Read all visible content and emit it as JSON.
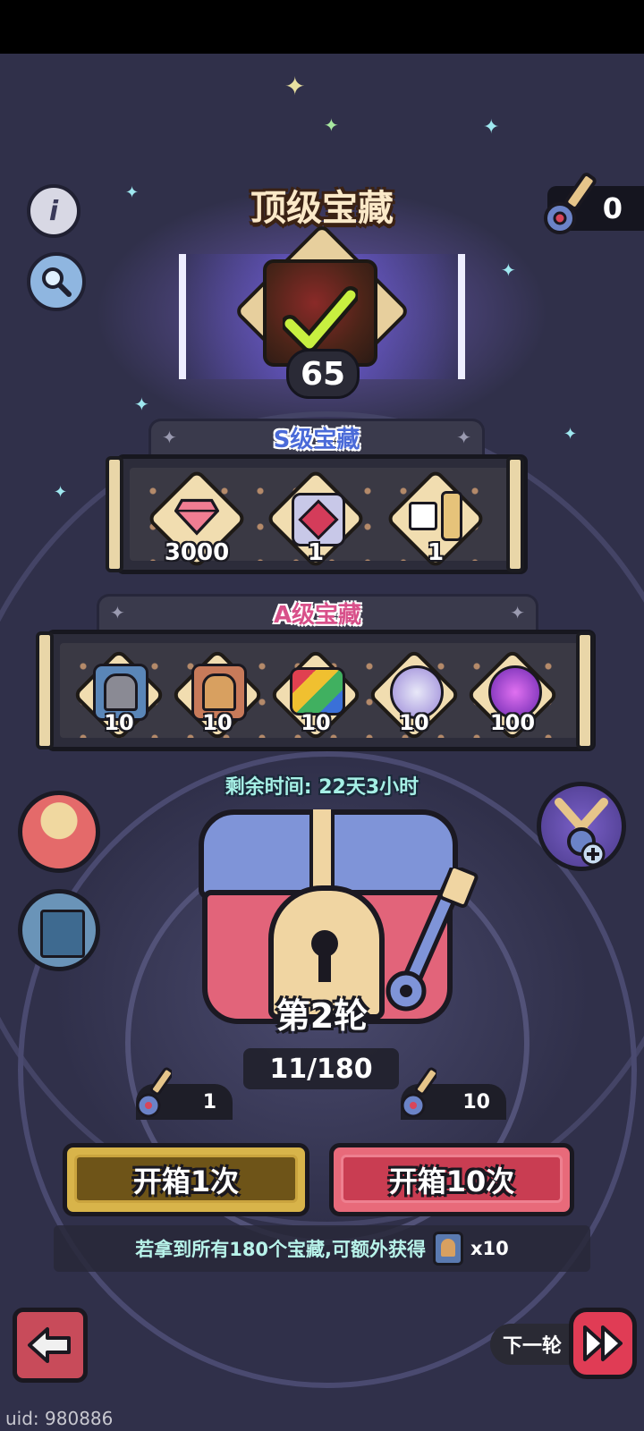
{
  "header": {
    "title": "顶级宝藏",
    "key_count": "0"
  },
  "top_reward": {
    "count": "65",
    "status": "checkmark"
  },
  "s_tier": {
    "label": "S级宝藏",
    "items": [
      {
        "icon": "pink-gem-icon",
        "qty": "3000"
      },
      {
        "icon": "crystal-emblem-icon",
        "qty": "1"
      },
      {
        "icon": "ssr-summon-icon",
        "qty": "1"
      }
    ]
  },
  "a_tier": {
    "label": "A级宝藏",
    "items": [
      {
        "icon": "gray-helmet-card-icon",
        "qty": "10"
      },
      {
        "icon": "gold-helmet-card-icon",
        "qty": "10"
      },
      {
        "icon": "color-book-icon",
        "qty": "10"
      },
      {
        "icon": "armor-orb-icon",
        "qty": "10"
      },
      {
        "icon": "purple-orb-icon",
        "qty": "100"
      }
    ]
  },
  "timer": {
    "text": "剩余时间: 22天3小时"
  },
  "chest": {
    "round": "第2轮",
    "progress": "11/180"
  },
  "actions": {
    "open_once": {
      "label": "开箱1次",
      "cost": "1"
    },
    "open_ten": {
      "label": "开箱10次",
      "cost": "10"
    }
  },
  "bonus": {
    "text": "若拿到所有180个宝藏,可额外获得",
    "reward_qty": "x10"
  },
  "footer": {
    "next_round": "下一轮",
    "uid": "uid: 980886"
  },
  "colors": {
    "background": "#3a3a58",
    "open_once_button": "#b8932e",
    "open_ten_button": "#d6485e",
    "timer_text": "#a6f0e6"
  }
}
